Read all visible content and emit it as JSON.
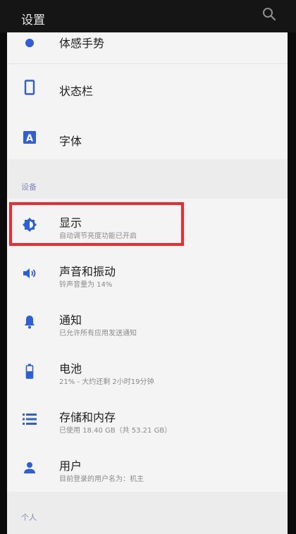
{
  "header": {
    "title": "设置"
  },
  "items_top": [
    {
      "label": "体感手势",
      "icon": "gesture-icon"
    },
    {
      "label": "状态栏",
      "icon": "phone-outline-icon"
    },
    {
      "label": "字体",
      "icon": "font-a-icon"
    }
  ],
  "section_device": "设备",
  "items_device": [
    {
      "label": "显示",
      "sub": "自动调节亮度功能已开启",
      "icon": "brightness-icon"
    },
    {
      "label": "声音和振动",
      "sub": "铃声音量为 14%",
      "icon": "speaker-icon"
    },
    {
      "label": "通知",
      "sub": "已允许所有应用发送通知",
      "icon": "bell-icon"
    },
    {
      "label": "电池",
      "sub": "21% - 大约还剩 2小时19分钟",
      "icon": "battery-icon"
    },
    {
      "label": "存储和内存",
      "sub": "已使用 18.40 GB（共 53.21 GB）",
      "icon": "storage-icon"
    },
    {
      "label": "用户",
      "sub": "目前登录的用户名为：机主",
      "icon": "user-icon"
    }
  ],
  "section_personal": "个人",
  "colors": {
    "accent": "#2f5fd8",
    "highlight": "#ee2b32"
  }
}
